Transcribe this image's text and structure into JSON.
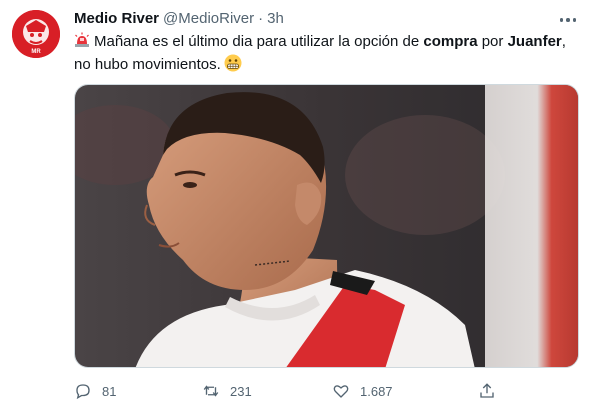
{
  "tweet": {
    "author_name": "Medio River",
    "author_handle": "@MedioRiver",
    "separator": "·",
    "time": "3h",
    "text_part1": "Mañana es el último dia para utilizar la opción de ",
    "text_bold1": "compra",
    "text_part2": " por ",
    "text_bold2": "Juanfer",
    "text_part3": ",",
    "text_line2": "no hubo movimientos.",
    "lead_emoji": "rotating-light-icon",
    "trailing_emoji": "grimacing-face-icon"
  },
  "avatar": {
    "text": "MR"
  },
  "stats": {
    "replies": "81",
    "retweets": "231",
    "likes": "1.687"
  },
  "colors": {
    "brand_red": "#d81f26",
    "text": "#0f1419",
    "muted": "#536471"
  },
  "icons": {
    "reply": "reply-icon",
    "retweet": "retweet-icon",
    "like": "heart-icon",
    "share": "share-icon",
    "more": "more-horizontal-icon"
  }
}
